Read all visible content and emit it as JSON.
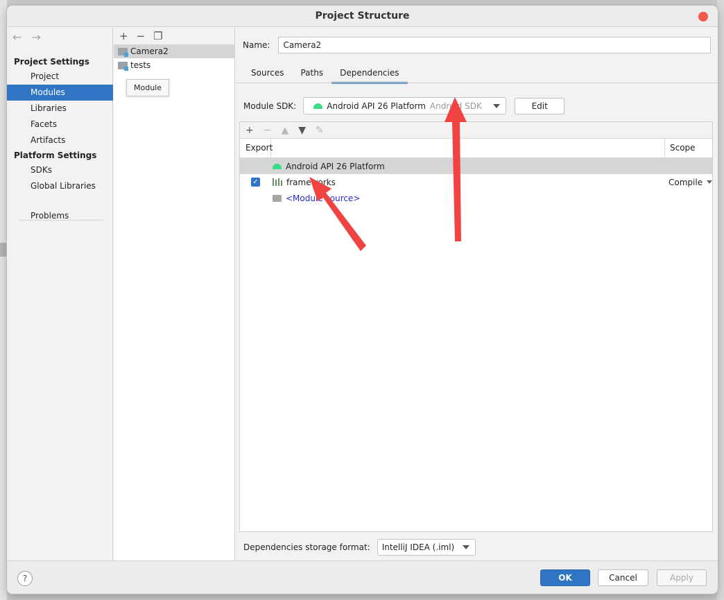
{
  "window": {
    "title": "Project Structure"
  },
  "nav": {
    "project_settings_header": "Project Settings",
    "project": "Project",
    "modules": "Modules",
    "libraries": "Libraries",
    "facets": "Facets",
    "artifacts": "Artifacts",
    "platform_settings_header": "Platform Settings",
    "sdks": "SDKs",
    "global_libraries": "Global Libraries",
    "problems": "Problems"
  },
  "modules_panel": {
    "items": [
      "Camera2",
      "tests"
    ],
    "tooltip": "Module"
  },
  "content": {
    "name_label": "Name:",
    "name_value": "Camera2",
    "tabs": [
      "Sources",
      "Paths",
      "Dependencies"
    ],
    "module_sdk_label": "Module SDK:",
    "sdk_name": "Android API 26 Platform",
    "sdk_type": "Android SDK",
    "edit_button": "Edit",
    "table": {
      "col_export": "Export",
      "col_scope": "Scope",
      "rows": [
        {
          "name": "Android API 26 Platform",
          "icon": "android-icon",
          "checked": false,
          "scope": ""
        },
        {
          "name": "frameworks",
          "icon": "library-icon",
          "checked": true,
          "scope": "Compile"
        },
        {
          "name": "<Module source>",
          "icon": "folder-icon",
          "checked": false,
          "scope": ""
        }
      ]
    },
    "storage_label": "Dependencies storage format:",
    "storage_value": "IntelliJ IDEA (.iml)"
  },
  "buttons": {
    "ok": "OK",
    "cancel": "Cancel",
    "apply": "Apply",
    "help": "?"
  },
  "colors": {
    "accent": "#2f75c4",
    "annotation_arrow": "#f24343",
    "close_button": "#f05a4f"
  }
}
